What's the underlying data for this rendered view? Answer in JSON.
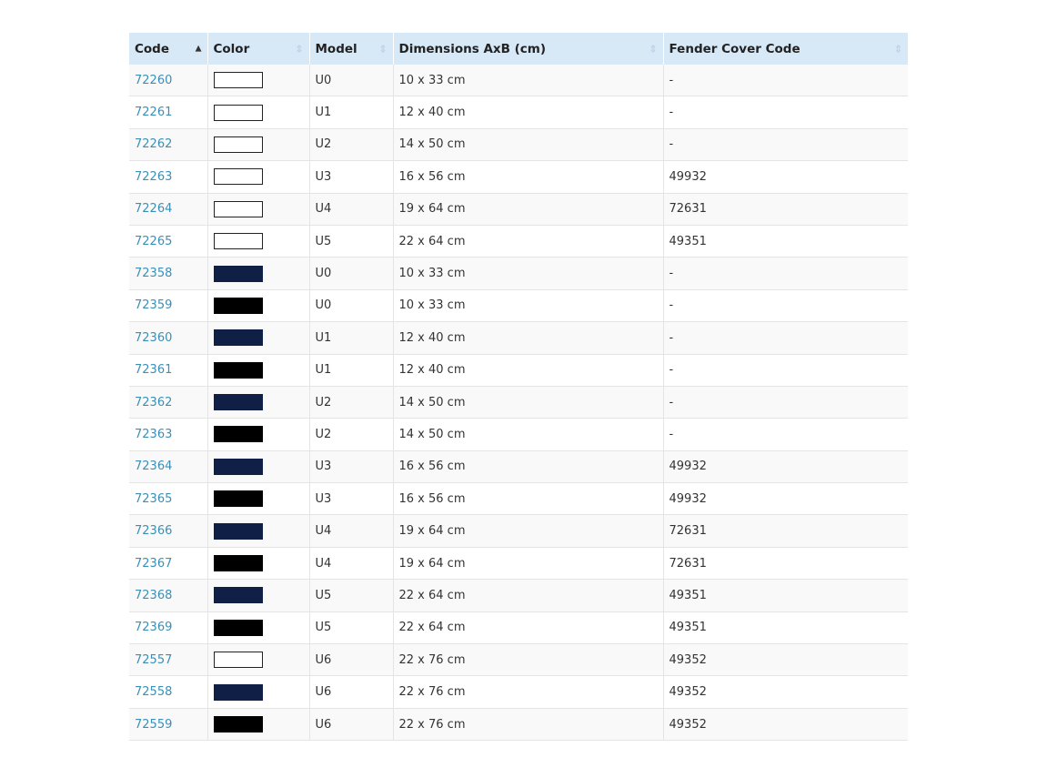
{
  "table": {
    "headers": [
      "Code",
      "Color",
      "Model",
      "Dimensions AxB (cm)",
      "Fender Cover Code"
    ],
    "sort": {
      "active_column": "Code",
      "direction": "ascending"
    },
    "colors": {
      "white": "#ffffff",
      "navy": "#0f1f45",
      "black": "#000000",
      "link": "#3a8fb7",
      "header_bg": "#d7e8f7"
    },
    "rows": [
      {
        "code": "72260",
        "color": "white",
        "model": "U0",
        "dimensions": "10 x 33 cm",
        "fender": "-"
      },
      {
        "code": "72261",
        "color": "white",
        "model": "U1",
        "dimensions": "12 x 40 cm",
        "fender": "-"
      },
      {
        "code": "72262",
        "color": "white",
        "model": "U2",
        "dimensions": "14 x 50 cm",
        "fender": "-"
      },
      {
        "code": "72263",
        "color": "white",
        "model": "U3",
        "dimensions": "16 x 56 cm",
        "fender": "49932"
      },
      {
        "code": "72264",
        "color": "white",
        "model": "U4",
        "dimensions": "19 x 64 cm",
        "fender": "72631"
      },
      {
        "code": "72265",
        "color": "white",
        "model": "U5",
        "dimensions": "22 x 64 cm",
        "fender": "49351"
      },
      {
        "code": "72358",
        "color": "navy",
        "model": "U0",
        "dimensions": "10 x 33 cm",
        "fender": "-"
      },
      {
        "code": "72359",
        "color": "black",
        "model": "U0",
        "dimensions": "10 x 33 cm",
        "fender": "-"
      },
      {
        "code": "72360",
        "color": "navy",
        "model": "U1",
        "dimensions": "12 x 40 cm",
        "fender": "-"
      },
      {
        "code": "72361",
        "color": "black",
        "model": "U1",
        "dimensions": "12 x 40 cm",
        "fender": "-"
      },
      {
        "code": "72362",
        "color": "navy",
        "model": "U2",
        "dimensions": "14 x 50 cm",
        "fender": "-"
      },
      {
        "code": "72363",
        "color": "black",
        "model": "U2",
        "dimensions": "14 x 50 cm",
        "fender": "-"
      },
      {
        "code": "72364",
        "color": "navy",
        "model": "U3",
        "dimensions": "16 x 56 cm",
        "fender": "49932"
      },
      {
        "code": "72365",
        "color": "black",
        "model": "U3",
        "dimensions": "16 x 56 cm",
        "fender": "49932"
      },
      {
        "code": "72366",
        "color": "navy",
        "model": "U4",
        "dimensions": "19 x 64 cm",
        "fender": "72631"
      },
      {
        "code": "72367",
        "color": "black",
        "model": "U4",
        "dimensions": "19 x 64 cm",
        "fender": "72631"
      },
      {
        "code": "72368",
        "color": "navy",
        "model": "U5",
        "dimensions": "22 x 64 cm",
        "fender": "49351"
      },
      {
        "code": "72369",
        "color": "black",
        "model": "U5",
        "dimensions": "22 x 64 cm",
        "fender": "49351"
      },
      {
        "code": "72557",
        "color": "white",
        "model": "U6",
        "dimensions": "22 x 76 cm",
        "fender": "49352"
      },
      {
        "code": "72558",
        "color": "navy",
        "model": "U6",
        "dimensions": "22 x 76 cm",
        "fender": "49352"
      },
      {
        "code": "72559",
        "color": "black",
        "model": "U6",
        "dimensions": "22 x 76 cm",
        "fender": "49352"
      }
    ]
  }
}
